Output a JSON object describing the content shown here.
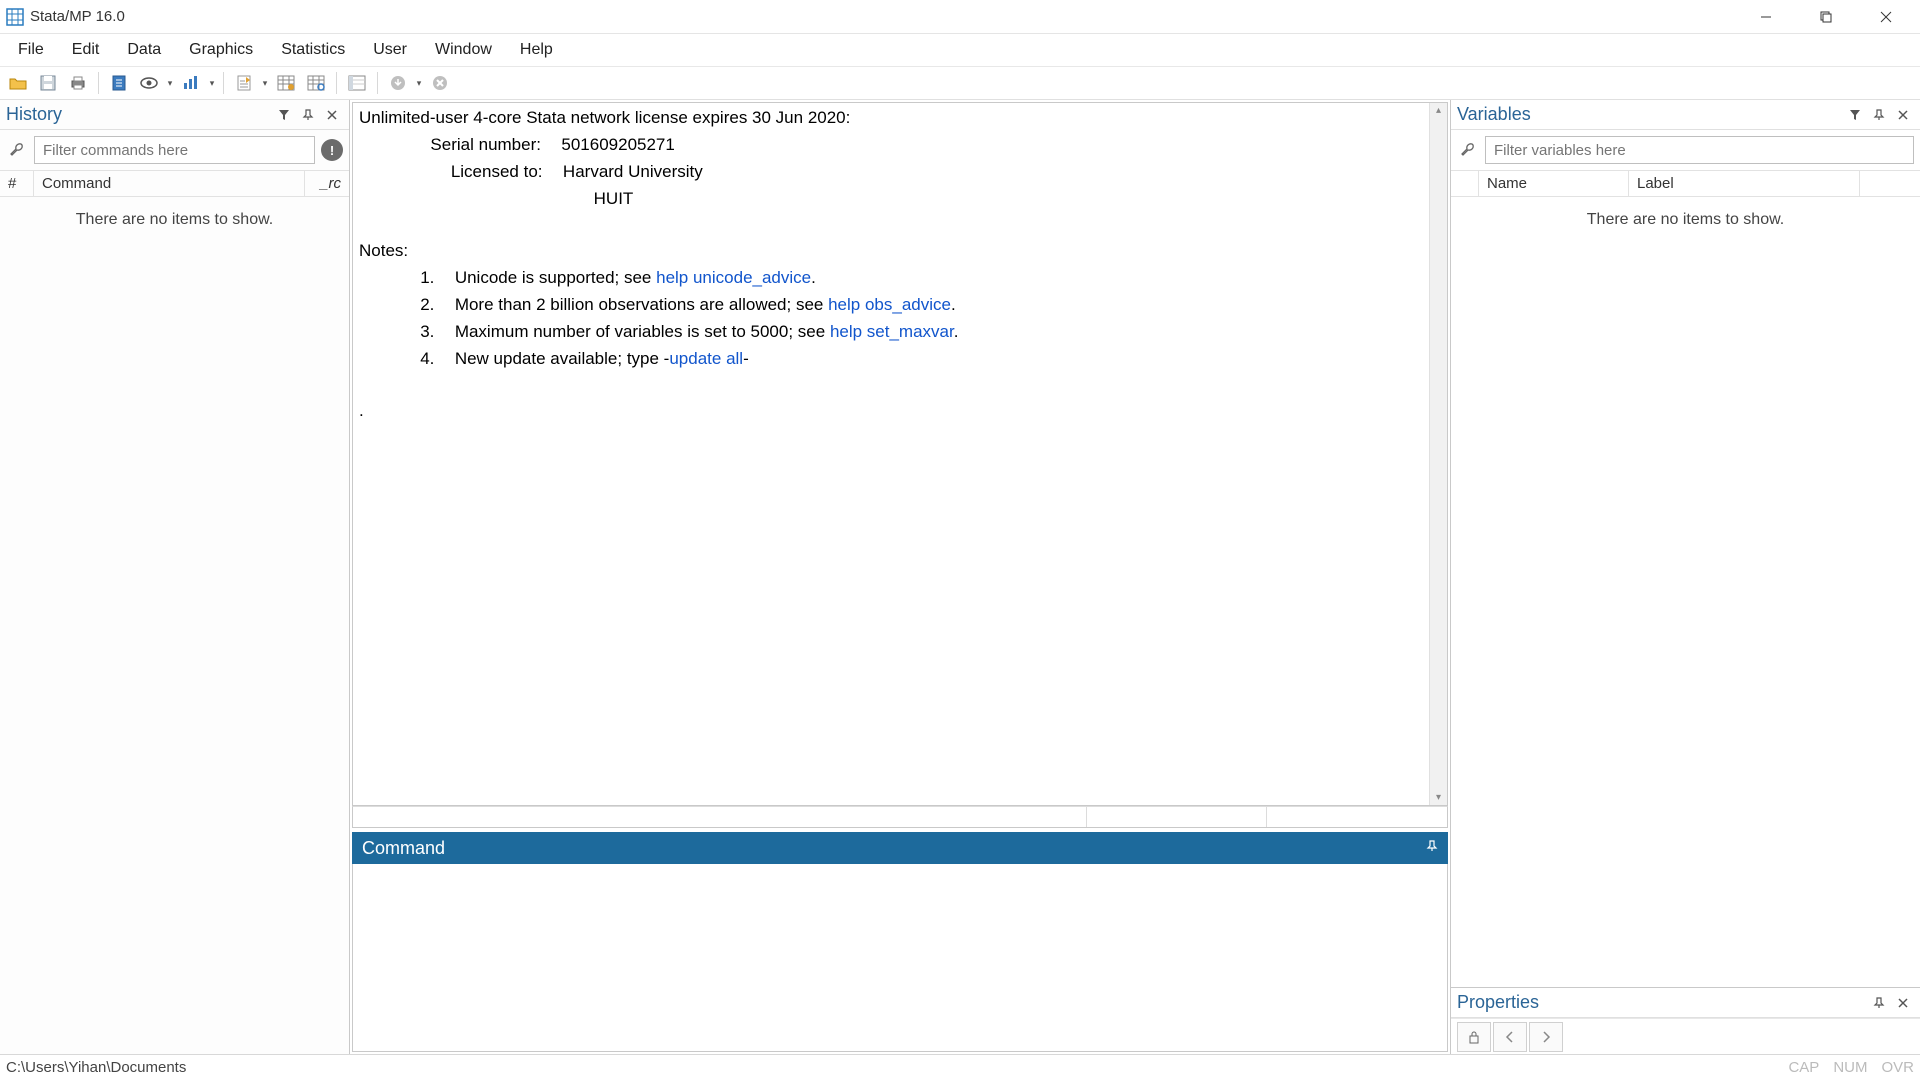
{
  "title": "Stata/MP 16.0",
  "menu": [
    "File",
    "Edit",
    "Data",
    "Graphics",
    "Statistics",
    "User",
    "Window",
    "Help"
  ],
  "history": {
    "title": "History",
    "filter_placeholder": "Filter commands here",
    "cols": {
      "num": "#",
      "cmd": "Command",
      "rc": "_rc"
    },
    "empty": "There are no items to show."
  },
  "results": {
    "license_line": "Unlimited-user 4-core Stata network license expires 30 Jun 2020:",
    "serial_label": "Serial number:",
    "serial_value": "501609205271",
    "licensed_label": "Licensed to:",
    "licensed_value1": "Harvard University",
    "licensed_value2": "HUIT",
    "notes_label": "Notes:",
    "notes": [
      {
        "n": "1.",
        "pre": "Unicode is supported; see ",
        "link": "help unicode_advice",
        "post": "."
      },
      {
        "n": "2.",
        "pre": "More than 2 billion observations are allowed; see ",
        "link": "help obs_advice",
        "post": "."
      },
      {
        "n": "3.",
        "pre": "Maximum number of variables is set to 5000; see ",
        "link": "help set_maxvar",
        "post": "."
      },
      {
        "n": "4.",
        "pre": "New update available; type -",
        "link": "update all",
        "post": "-"
      }
    ],
    "prompt": "."
  },
  "command": {
    "title": "Command",
    "value": ""
  },
  "variables": {
    "title": "Variables",
    "filter_placeholder": "Filter variables here",
    "cols": {
      "name": "Name",
      "label": "Label"
    },
    "empty": "There are no items to show."
  },
  "properties": {
    "title": "Properties"
  },
  "statusbar": {
    "path": "C:\\Users\\Yihan\\Documents",
    "cap": "CAP",
    "num": "NUM",
    "ovr": "OVR"
  }
}
